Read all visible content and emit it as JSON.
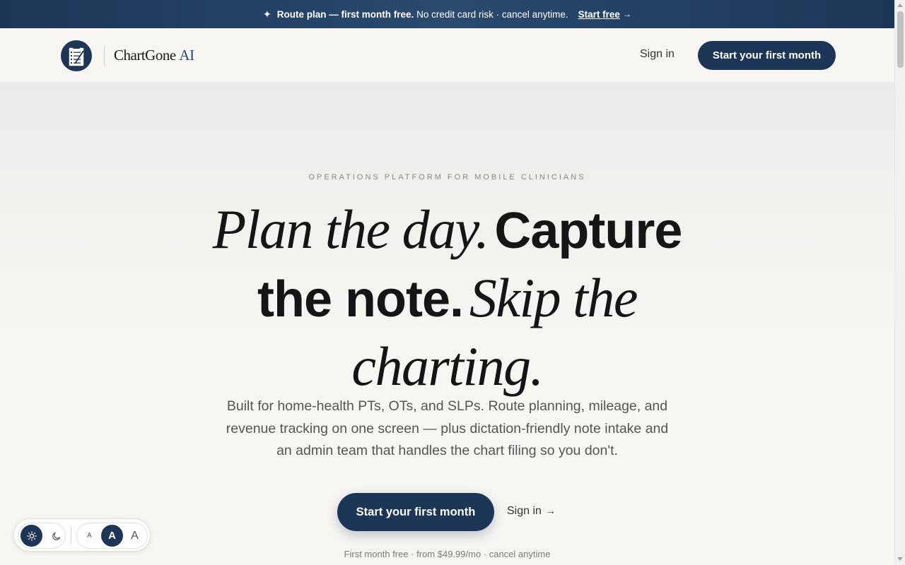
{
  "promo": {
    "plan": "Route plan —",
    "offer": "first month free.",
    "rest": "No credit card risk · cancel anytime.",
    "cta": "Start free"
  },
  "header": {
    "brand_name": "ChartGone",
    "brand_suffix": "AI",
    "sign_in": "Sign in",
    "cta": "Start your first month"
  },
  "hero": {
    "eyebrow": "OPERATIONS PLATFORM FOR MOBILE CLINICIANS",
    "headline": {
      "part1": "Plan the day.",
      "part2": "Capture",
      "part3": "the note.",
      "part4": "Skip the",
      "part5": "charting."
    },
    "subtext": "Built for home-health PTs, OTs, and SLPs. Route planning, mileage, and revenue tracking on one screen — plus dictation-friendly note intake and an admin team that handles the chart filing so you don't.",
    "cta": "Start your first month",
    "sign_in": "Sign in",
    "fineprint": "First month free · from $49.99/mo · cancel anytime"
  },
  "a11y": {
    "size_small": "A",
    "size_medium": "A",
    "size_large": "A"
  },
  "colors": {
    "primary": "#1d3557",
    "background": "#f7f6f3"
  }
}
